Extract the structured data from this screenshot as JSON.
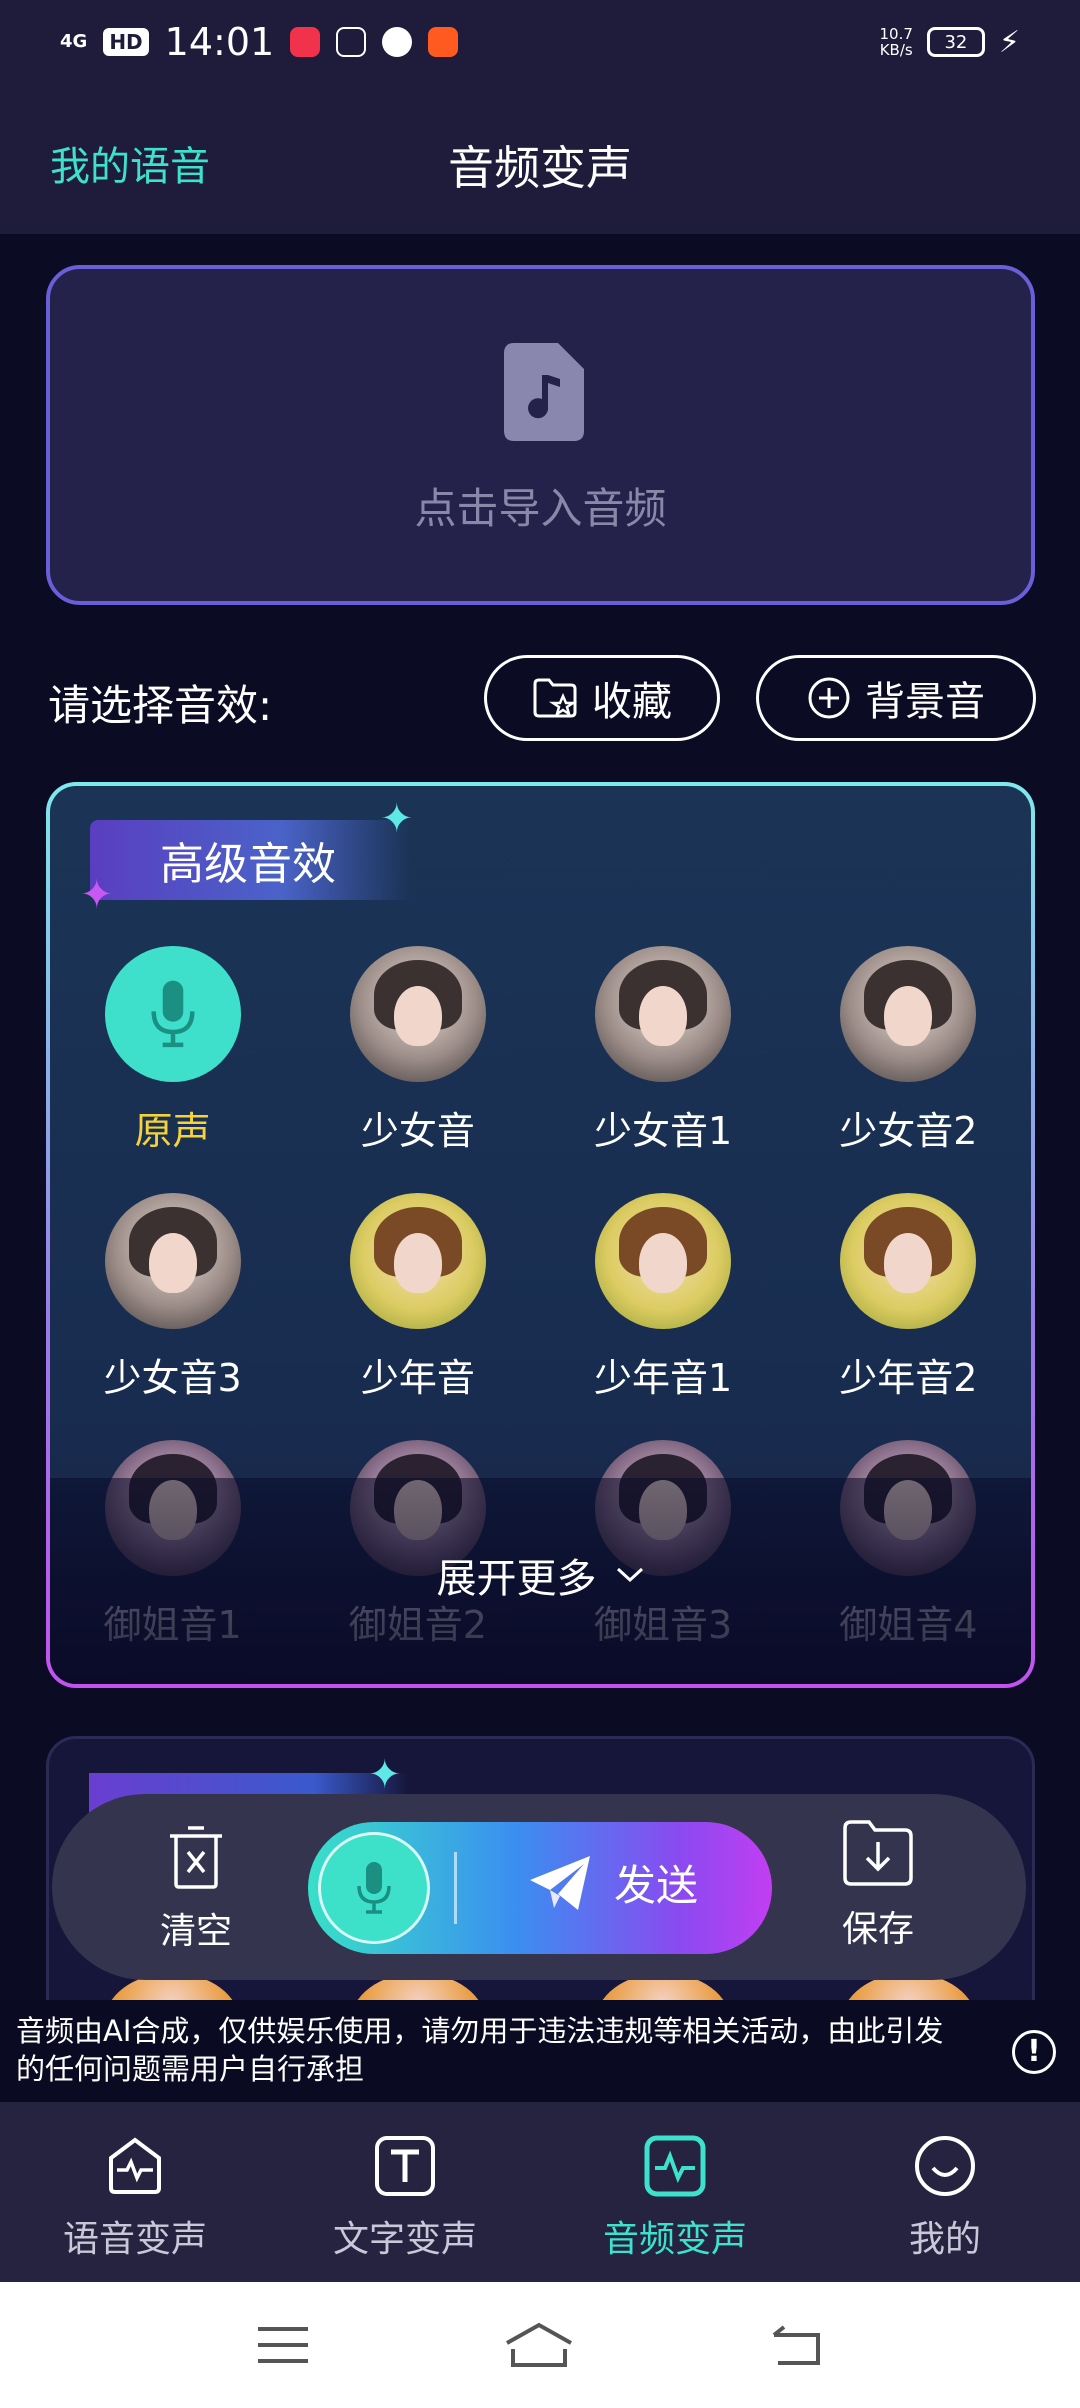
{
  "status_bar": {
    "network": "4G",
    "hd": "HD",
    "time": "14:01",
    "speed_value": "10.7",
    "speed_unit": "KB/s",
    "battery": "32"
  },
  "header": {
    "left_link": "我的语音",
    "title": "音频变声"
  },
  "import": {
    "label": "点击导入音频"
  },
  "effects": {
    "select_label": "请选择音效:",
    "favorites_label": "收藏",
    "background_label": "背景音",
    "panel_title": "高级音效",
    "items": [
      {
        "label": "原声",
        "kind": "mic"
      },
      {
        "label": "少女音",
        "kind": "girl"
      },
      {
        "label": "少女音1",
        "kind": "girl"
      },
      {
        "label": "少女音2",
        "kind": "girl"
      },
      {
        "label": "少女音3",
        "kind": "girl"
      },
      {
        "label": "少年音",
        "kind": "boy"
      },
      {
        "label": "少年音1",
        "kind": "boy"
      },
      {
        "label": "少年音2",
        "kind": "boy"
      },
      {
        "label": "御姐音1",
        "kind": "lady"
      },
      {
        "label": "御姐音2",
        "kind": "lady"
      },
      {
        "label": "御姐音3",
        "kind": "lady"
      },
      {
        "label": "御姐音4",
        "kind": "lady"
      }
    ],
    "expand_label": "展开更多"
  },
  "actions": {
    "clear_label": "清空",
    "send_label": "发送",
    "save_label": "保存"
  },
  "disclaimer": "音频由AI合成，仅供娱乐使用，请勿用于违法违规等相关活动，由此引发的任何问题需用户自行承担",
  "bottom_nav": [
    {
      "label": "语音变声",
      "icon": "voice-change-icon"
    },
    {
      "label": "文字变声",
      "icon": "text-change-icon"
    },
    {
      "label": "音频变声",
      "icon": "audio-change-icon"
    },
    {
      "label": "我的",
      "icon": "smile-icon"
    }
  ],
  "colors": {
    "accent": "#3de2cc",
    "selected_label": "#f6d33a",
    "background": "#0b0b24"
  }
}
